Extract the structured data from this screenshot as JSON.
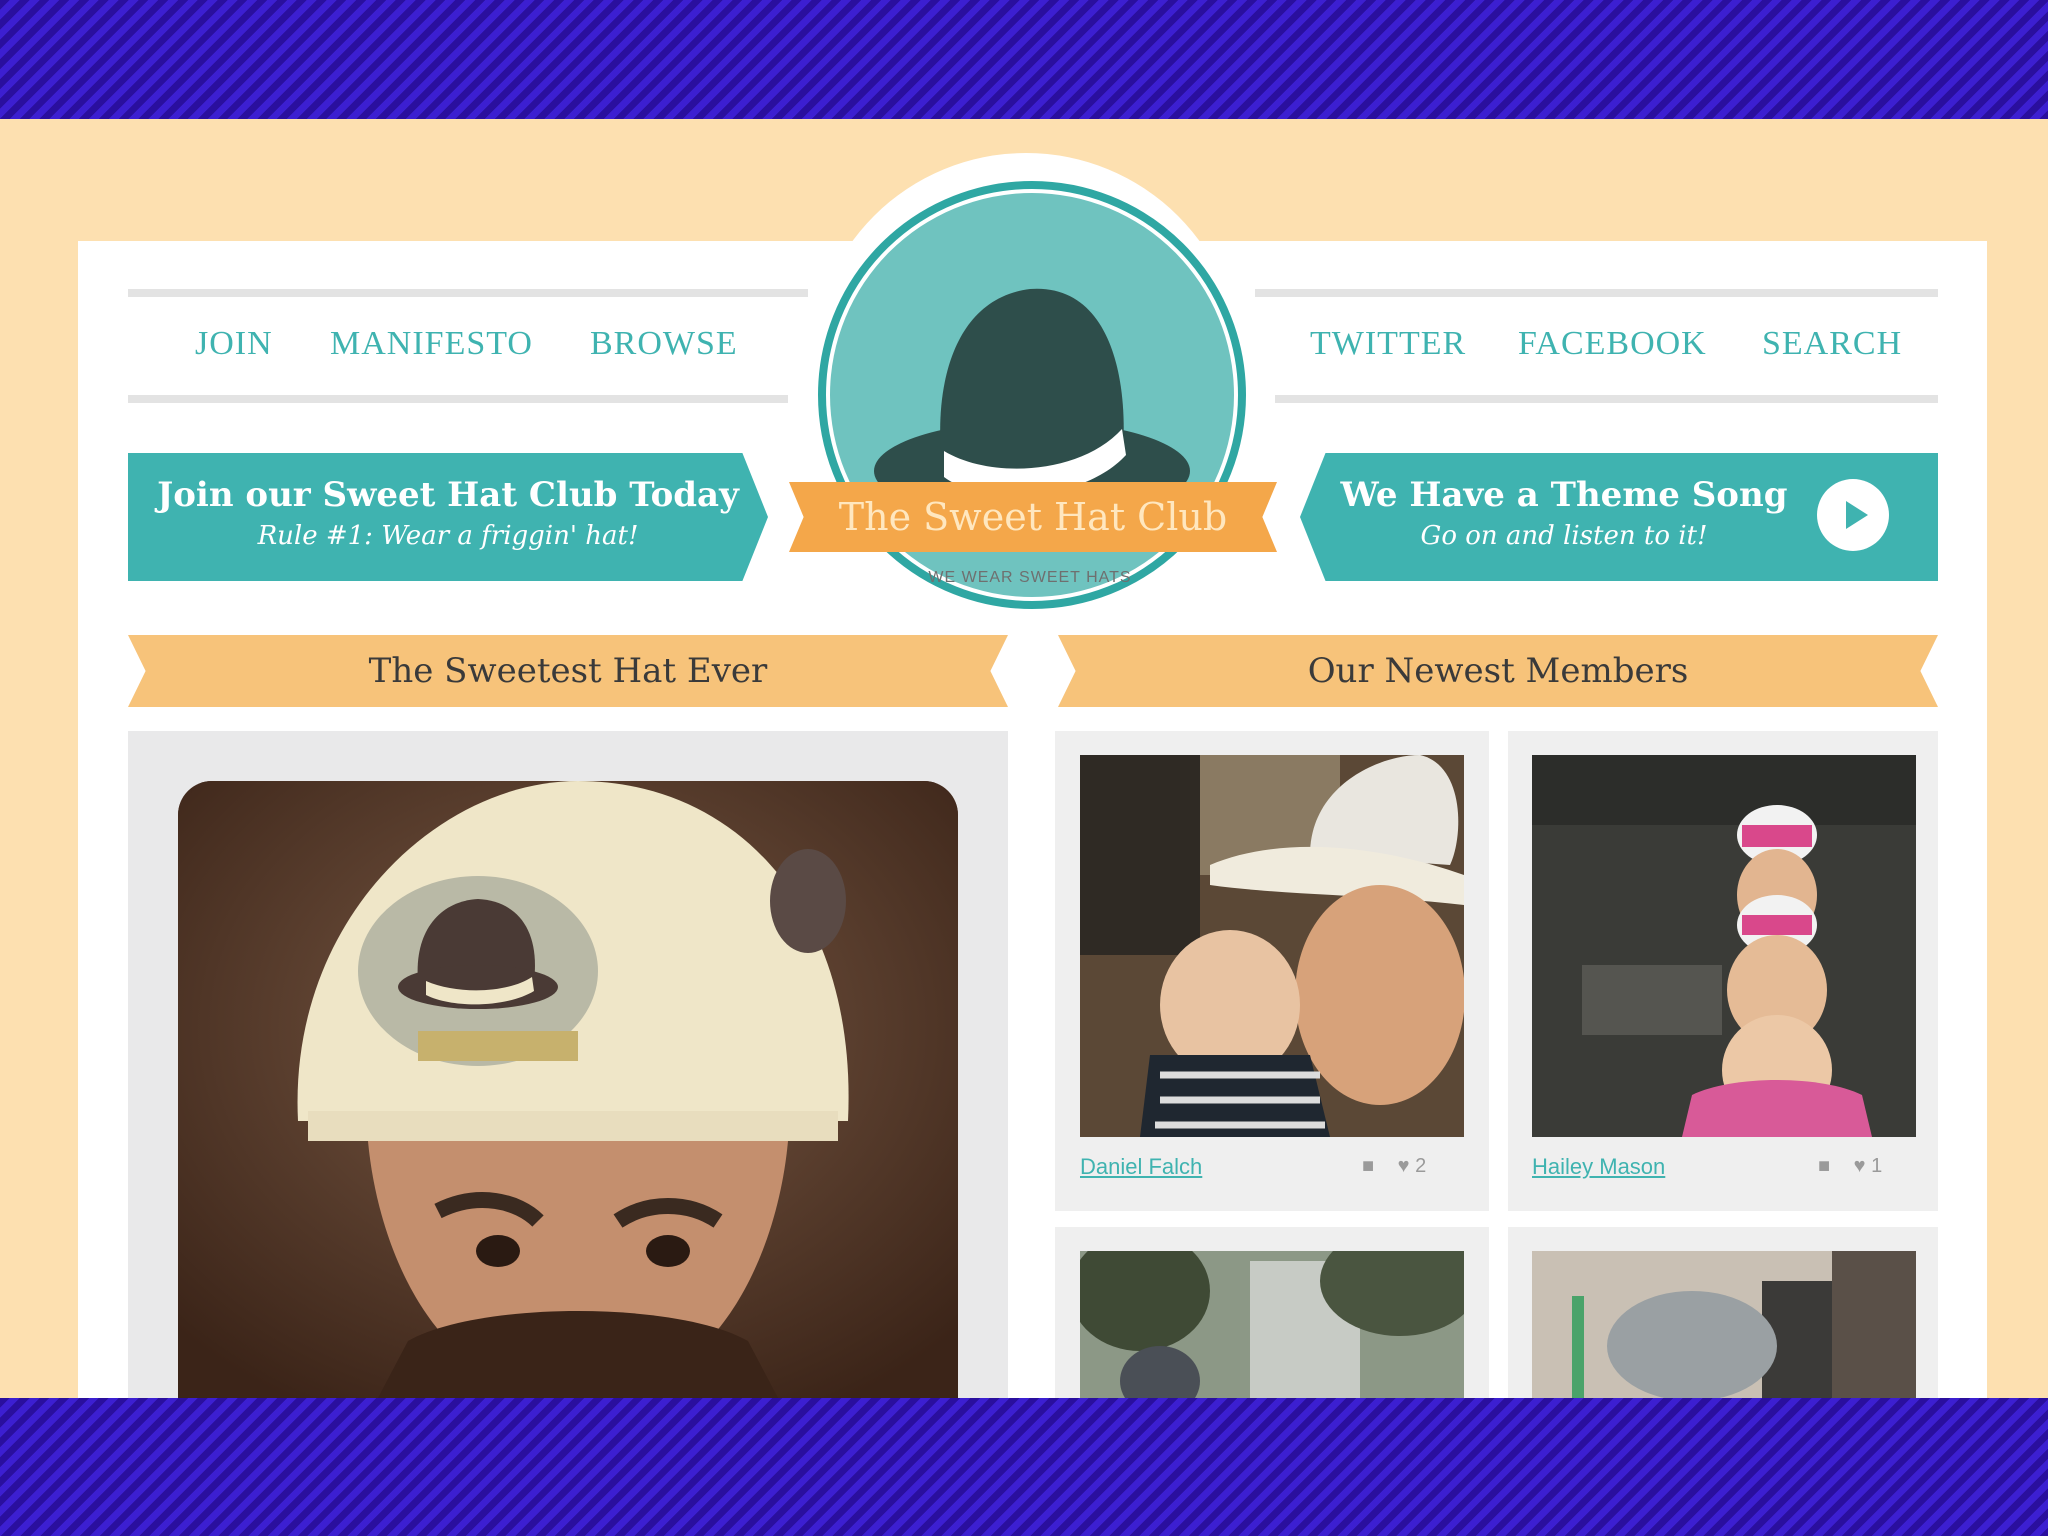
{
  "nav": {
    "left": [
      "JOIN",
      "MANIFESTO",
      "BROWSE"
    ],
    "right": [
      "TWITTER",
      "FACEBOOK",
      "SEARCH"
    ]
  },
  "logo": {
    "title": "The Sweet Hat Club",
    "tagline": "WE WEAR SWEET HATS"
  },
  "banners": {
    "left": {
      "title": "Join our Sweet Hat Club Today",
      "subtitle": "Rule #1: Wear a friggin' hat!"
    },
    "right": {
      "title": "We Have a Theme Song",
      "subtitle": "Go on and listen to it!"
    }
  },
  "sections": {
    "featured_title": "The Sweetest Hat Ever",
    "members_title": "Our Newest Members"
  },
  "members": [
    {
      "name": "Daniel Falch",
      "likes": "2"
    },
    {
      "name": "Hailey Mason",
      "likes": "1"
    }
  ],
  "colors": {
    "teal": "#3fb3b0",
    "orange": "#f4a74a",
    "peach": "#fde0b0",
    "stripe": "#2a0f9e"
  }
}
